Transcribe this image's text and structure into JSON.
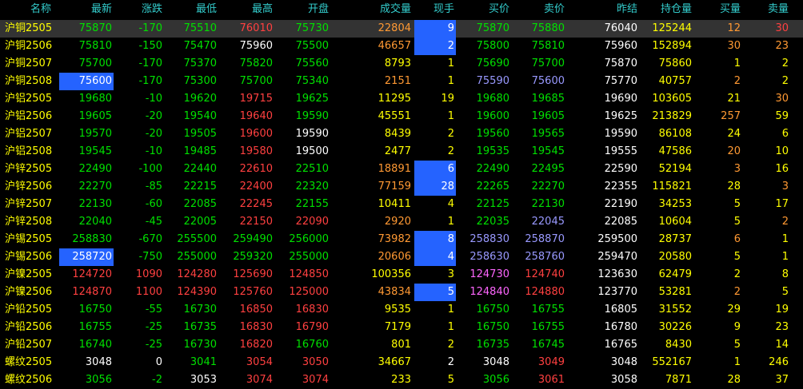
{
  "headers": [
    "名称",
    "最新",
    "涨跌",
    "最低",
    "最高",
    "开盘",
    "成交量",
    "现手",
    "买价",
    "卖价",
    "昨结",
    "持仓量",
    "买量",
    "卖量"
  ],
  "colors": {
    "selected_bg": "#333333",
    "highlight": "#2563FF",
    "header": "#33CCCC"
  },
  "selected_row": 0,
  "rows": [
    {
      "cells": [
        "沪铜2505",
        "75870",
        "-170",
        "75510",
        "76010",
        "75730",
        "22804",
        "9",
        "75870",
        "75880",
        "76040",
        "125244",
        "12",
        "30"
      ],
      "colors": [
        "y",
        "g",
        "g",
        "g",
        "r",
        "g",
        "o",
        "w",
        "g",
        "g",
        "w",
        "y",
        "o",
        "r"
      ],
      "hl": [
        7
      ]
    },
    {
      "cells": [
        "沪铜2506",
        "75810",
        "-150",
        "75470",
        "75960",
        "75500",
        "46657",
        "2",
        "75800",
        "75810",
        "75960",
        "152894",
        "30",
        "23"
      ],
      "colors": [
        "y",
        "g",
        "g",
        "g",
        "w",
        "g",
        "o",
        "w",
        "g",
        "g",
        "w",
        "y",
        "o",
        "o"
      ],
      "hl": [
        7
      ]
    },
    {
      "cells": [
        "沪铜2507",
        "75700",
        "-170",
        "75370",
        "75820",
        "75560",
        "8793",
        "1",
        "75690",
        "75700",
        "75870",
        "75860",
        "1",
        "2"
      ],
      "colors": [
        "y",
        "g",
        "g",
        "g",
        "g",
        "g",
        "y",
        "y",
        "g",
        "g",
        "w",
        "y",
        "y",
        "y"
      ],
      "hl": []
    },
    {
      "cells": [
        "沪铜2508",
        "75600",
        "-170",
        "75300",
        "75700",
        "75340",
        "2151",
        "1",
        "75590",
        "75600",
        "75770",
        "40757",
        "2",
        "2"
      ],
      "colors": [
        "y",
        "w",
        "g",
        "g",
        "g",
        "g",
        "o",
        "y",
        "lb",
        "lb",
        "w",
        "y",
        "o",
        "y"
      ],
      "hl": [
        1
      ]
    },
    {
      "cells": [
        "沪铝2505",
        "19680",
        "-10",
        "19620",
        "19715",
        "19625",
        "11295",
        "19",
        "19680",
        "19685",
        "19690",
        "103605",
        "21",
        "30"
      ],
      "colors": [
        "y",
        "g",
        "g",
        "g",
        "r",
        "g",
        "y",
        "y",
        "g",
        "g",
        "w",
        "y",
        "y",
        "o"
      ],
      "hl": []
    },
    {
      "cells": [
        "沪铝2506",
        "19605",
        "-20",
        "19540",
        "19640",
        "19590",
        "45551",
        "1",
        "19600",
        "19605",
        "19625",
        "213829",
        "257",
        "59"
      ],
      "colors": [
        "y",
        "g",
        "g",
        "g",
        "r",
        "g",
        "y",
        "y",
        "g",
        "g",
        "w",
        "y",
        "o",
        "y"
      ],
      "hl": []
    },
    {
      "cells": [
        "沪铝2507",
        "19570",
        "-20",
        "19505",
        "19600",
        "19590",
        "8439",
        "2",
        "19560",
        "19565",
        "19590",
        "86108",
        "24",
        "6"
      ],
      "colors": [
        "y",
        "g",
        "g",
        "g",
        "r",
        "w",
        "y",
        "y",
        "g",
        "g",
        "w",
        "y",
        "y",
        "y"
      ],
      "hl": []
    },
    {
      "cells": [
        "沪铝2508",
        "19545",
        "-10",
        "19485",
        "19580",
        "19500",
        "2477",
        "2",
        "19535",
        "19545",
        "19555",
        "47586",
        "20",
        "10"
      ],
      "colors": [
        "y",
        "g",
        "g",
        "g",
        "r",
        "w",
        "y",
        "y",
        "g",
        "g",
        "w",
        "y",
        "o",
        "y"
      ],
      "hl": []
    },
    {
      "cells": [
        "沪锌2505",
        "22490",
        "-100",
        "22440",
        "22610",
        "22510",
        "18891",
        "6",
        "22490",
        "22495",
        "22590",
        "52194",
        "3",
        "16"
      ],
      "colors": [
        "y",
        "g",
        "g",
        "g",
        "r",
        "g",
        "o",
        "w",
        "g",
        "g",
        "w",
        "y",
        "o",
        "y"
      ],
      "hl": [
        7
      ]
    },
    {
      "cells": [
        "沪锌2506",
        "22270",
        "-85",
        "22215",
        "22400",
        "22320",
        "77159",
        "28",
        "22265",
        "22270",
        "22355",
        "115821",
        "28",
        "3"
      ],
      "colors": [
        "y",
        "g",
        "g",
        "g",
        "r",
        "g",
        "o",
        "w",
        "g",
        "g",
        "w",
        "y",
        "y",
        "o"
      ],
      "hl": [
        7
      ]
    },
    {
      "cells": [
        "沪锌2507",
        "22130",
        "-60",
        "22085",
        "22245",
        "22155",
        "10411",
        "4",
        "22125",
        "22130",
        "22190",
        "34253",
        "5",
        "17"
      ],
      "colors": [
        "y",
        "g",
        "g",
        "g",
        "r",
        "g",
        "y",
        "y",
        "g",
        "g",
        "w",
        "y",
        "y",
        "y"
      ],
      "hl": []
    },
    {
      "cells": [
        "沪锌2508",
        "22040",
        "-45",
        "22005",
        "22150",
        "22090",
        "2920",
        "1",
        "22035",
        "22045",
        "22085",
        "10604",
        "5",
        "2"
      ],
      "colors": [
        "y",
        "g",
        "g",
        "g",
        "r",
        "r",
        "o",
        "y",
        "g",
        "lb",
        "w",
        "y",
        "y",
        "o"
      ],
      "hl": []
    },
    {
      "cells": [
        "沪锡2505",
        "258830",
        "-670",
        "255500",
        "259490",
        "256000",
        "73982",
        "8",
        "258830",
        "258870",
        "259500",
        "28737",
        "6",
        "1"
      ],
      "colors": [
        "y",
        "g",
        "g",
        "g",
        "g",
        "g",
        "o",
        "w",
        "lb",
        "lb",
        "w",
        "y",
        "o",
        "y"
      ],
      "hl": [
        7
      ]
    },
    {
      "cells": [
        "沪锡2506",
        "258720",
        "-750",
        "255000",
        "259320",
        "255000",
        "20606",
        "4",
        "258630",
        "258760",
        "259470",
        "20580",
        "5",
        "1"
      ],
      "colors": [
        "y",
        "w",
        "g",
        "g",
        "g",
        "g",
        "o",
        "w",
        "lb",
        "lb",
        "w",
        "y",
        "y",
        "y"
      ],
      "hl": [
        1,
        7
      ]
    },
    {
      "cells": [
        "沪镍2505",
        "124720",
        "1090",
        "124280",
        "125690",
        "124850",
        "100356",
        "3",
        "124730",
        "124740",
        "123630",
        "62479",
        "2",
        "8"
      ],
      "colors": [
        "y",
        "r",
        "r",
        "r",
        "r",
        "r",
        "y",
        "y",
        "m",
        "r",
        "w",
        "y",
        "y",
        "y"
      ],
      "hl": []
    },
    {
      "cells": [
        "沪镍2506",
        "124870",
        "1100",
        "124390",
        "125760",
        "125000",
        "43834",
        "5",
        "124840",
        "124880",
        "123770",
        "53281",
        "2",
        "5"
      ],
      "colors": [
        "y",
        "r",
        "r",
        "r",
        "r",
        "r",
        "o",
        "w",
        "m",
        "r",
        "w",
        "y",
        "o",
        "y"
      ],
      "hl": [
        7
      ]
    },
    {
      "cells": [
        "沪铅2505",
        "16750",
        "-55",
        "16730",
        "16850",
        "16830",
        "9535",
        "1",
        "16750",
        "16755",
        "16805",
        "31552",
        "29",
        "19"
      ],
      "colors": [
        "y",
        "g",
        "g",
        "g",
        "r",
        "r",
        "y",
        "y",
        "g",
        "g",
        "w",
        "y",
        "y",
        "y"
      ],
      "hl": []
    },
    {
      "cells": [
        "沪铅2506",
        "16755",
        "-25",
        "16735",
        "16830",
        "16790",
        "7179",
        "1",
        "16750",
        "16755",
        "16780",
        "30226",
        "9",
        "23"
      ],
      "colors": [
        "y",
        "g",
        "g",
        "g",
        "r",
        "r",
        "y",
        "y",
        "g",
        "g",
        "w",
        "y",
        "y",
        "y"
      ],
      "hl": []
    },
    {
      "cells": [
        "沪铅2507",
        "16740",
        "-25",
        "16730",
        "16820",
        "16760",
        "801",
        "2",
        "16735",
        "16745",
        "16765",
        "8430",
        "5",
        "14"
      ],
      "colors": [
        "y",
        "g",
        "g",
        "g",
        "r",
        "g",
        "y",
        "y",
        "g",
        "g",
        "w",
        "y",
        "y",
        "y"
      ],
      "hl": []
    },
    {
      "cells": [
        "螺纹2505",
        "3048",
        "0",
        "3041",
        "3054",
        "3050",
        "34667",
        "2",
        "3048",
        "3049",
        "3048",
        "552167",
        "1",
        "246"
      ],
      "colors": [
        "y",
        "w",
        "w",
        "g",
        "r",
        "r",
        "y",
        "w",
        "w",
        "r",
        "w",
        "y",
        "y",
        "y"
      ],
      "hl": []
    },
    {
      "cells": [
        "螺纹2506",
        "3056",
        "-2",
        "3053",
        "3074",
        "3074",
        "233",
        "5",
        "3056",
        "3061",
        "3058",
        "7871",
        "28",
        "37"
      ],
      "colors": [
        "y",
        "g",
        "g",
        "w",
        "r",
        "r",
        "y",
        "y",
        "g",
        "r",
        "w",
        "y",
        "y",
        "y"
      ],
      "hl": []
    }
  ]
}
